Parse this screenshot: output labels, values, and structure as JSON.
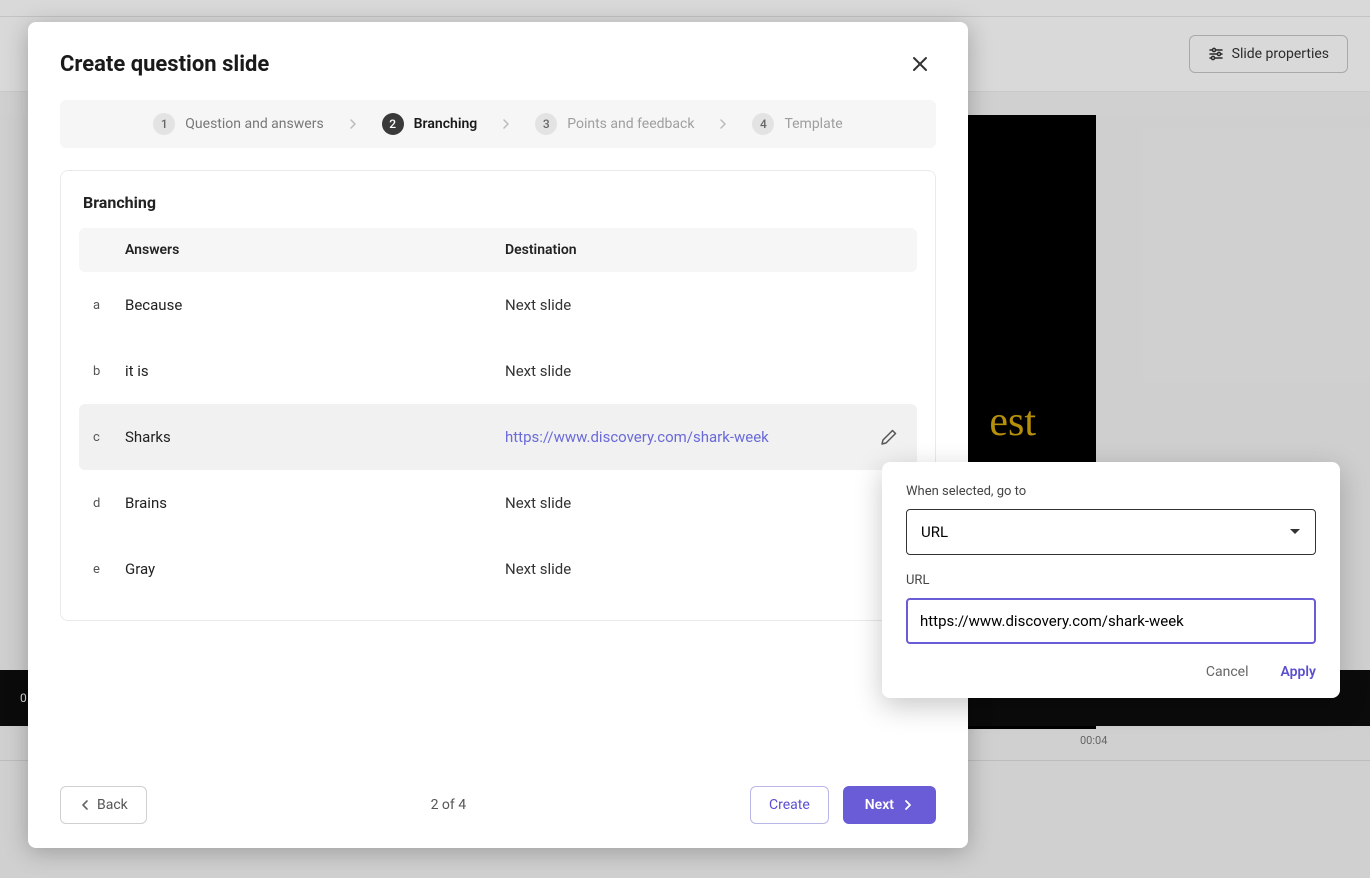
{
  "background": {
    "slide_properties_label": "Slide properties",
    "slide_text_snippet": "est",
    "timeline_start": "0",
    "timestamp": "00:04"
  },
  "modal": {
    "title": "Create question slide",
    "steps": [
      {
        "num": "1",
        "label": "Question and answers"
      },
      {
        "num": "2",
        "label": "Branching"
      },
      {
        "num": "3",
        "label": "Points and feedback"
      },
      {
        "num": "4",
        "label": "Template"
      }
    ],
    "card_title": "Branching",
    "columns": {
      "letter": "",
      "answers": "Answers",
      "destination": "Destination"
    },
    "rows": [
      {
        "letter": "a",
        "answer": "Because",
        "destination": "Next slide",
        "is_link": false,
        "selected": false
      },
      {
        "letter": "b",
        "answer": "it is",
        "destination": "Next slide",
        "is_link": false,
        "selected": false
      },
      {
        "letter": "c",
        "answer": "Sharks",
        "destination": "https://www.discovery.com/shark-week",
        "is_link": true,
        "selected": true
      },
      {
        "letter": "d",
        "answer": "Brains",
        "destination": "Next slide",
        "is_link": false,
        "selected": false
      },
      {
        "letter": "e",
        "answer": "Gray",
        "destination": "Next slide",
        "is_link": false,
        "selected": false
      }
    ],
    "footer": {
      "back": "Back",
      "page_info": "2 of 4",
      "create": "Create",
      "next": "Next"
    }
  },
  "popover": {
    "when_selected_label": "When selected, go to",
    "select_value": "URL",
    "url_label": "URL",
    "url_value": "https://www.discovery.com/shark-week",
    "cancel": "Cancel",
    "apply": "Apply"
  }
}
